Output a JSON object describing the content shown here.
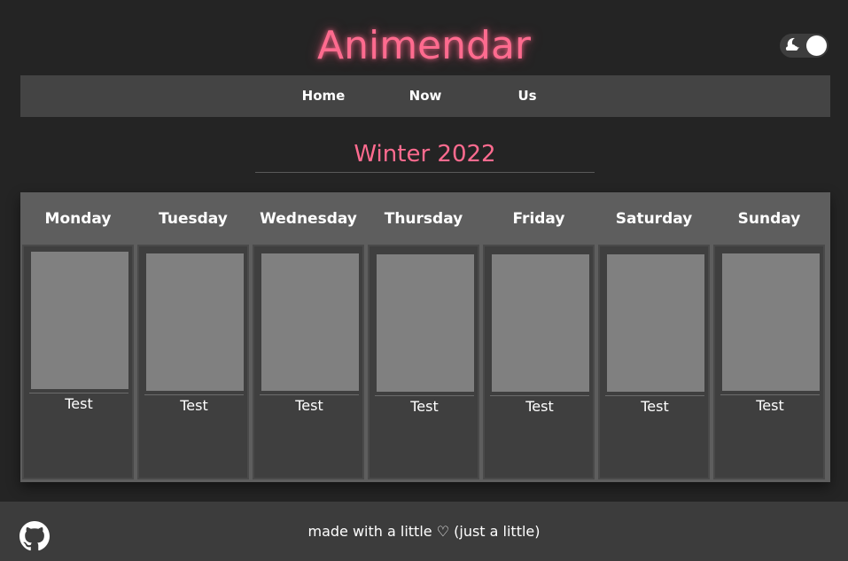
{
  "app": {
    "title": "Animendar",
    "accent_color": "#ff6b8f",
    "theme_toggle": {
      "icon": "moon-cloud-icon",
      "state": "dark"
    }
  },
  "nav": {
    "items": [
      {
        "label": "Home"
      },
      {
        "label": "Now"
      },
      {
        "label": "Us"
      }
    ]
  },
  "season": {
    "title": "Winter 2022"
  },
  "calendar": {
    "days": [
      {
        "name": "Monday",
        "shows": [
          {
            "title": "Test"
          }
        ]
      },
      {
        "name": "Tuesday",
        "shows": [
          {
            "title": "Test"
          }
        ]
      },
      {
        "name": "Wednesday",
        "shows": [
          {
            "title": "Test"
          }
        ]
      },
      {
        "name": "Thursday",
        "shows": [
          {
            "title": "Test"
          }
        ]
      },
      {
        "name": "Friday",
        "shows": [
          {
            "title": "Test"
          }
        ]
      },
      {
        "name": "Saturday",
        "shows": [
          {
            "title": "Test"
          }
        ]
      },
      {
        "name": "Sunday",
        "shows": [
          {
            "title": "Test"
          }
        ]
      }
    ]
  },
  "footer": {
    "github_icon": "github-icon",
    "text": "made with a little ♡ (just a little)"
  }
}
